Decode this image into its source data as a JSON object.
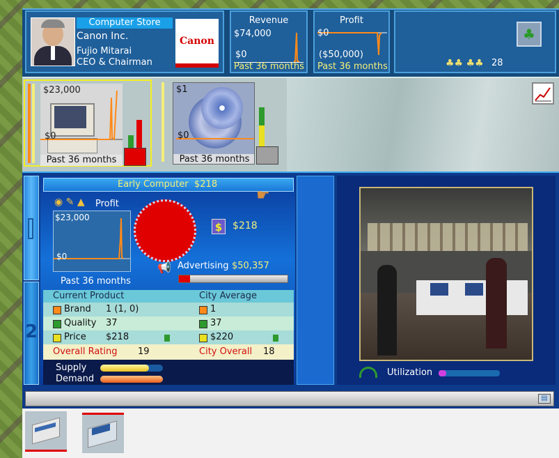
{
  "header": {
    "store_type": "Computer Store",
    "company": "Canon Inc.",
    "person_name": "Fujio Mitarai",
    "person_title": "CEO & Chairman",
    "logo_text": "Canon",
    "revenue": {
      "title": "Revenue",
      "max": "$74,000",
      "min": "$0",
      "period": "Past 36 months"
    },
    "profit": {
      "title": "Profit",
      "max": "$0",
      "min": "($50,000)",
      "period": "Past 36 months"
    },
    "employees_count": "28"
  },
  "units": [
    {
      "label": "Past 36 months",
      "max": "$23,000",
      "min": "$0"
    },
    {
      "label": "Past 36 months",
      "max": "$1",
      "min": "$0"
    }
  ],
  "detail": {
    "product_title": "Early Computer",
    "product_price": "$218",
    "profit_label": "Profit",
    "profit_max": "$23,000",
    "profit_min": "$0",
    "profit_period": "Past 36 months",
    "price_value": "$218",
    "advertising_label": "Advertising",
    "advertising_value": "$50,357",
    "advertising_level": 0.1,
    "left_tab_top": "1",
    "left_tab_bottom": "2",
    "table": {
      "col1": "Current Product",
      "col2": "City Average",
      "rows": [
        {
          "label": "Brand",
          "value": "1 (1, 0)",
          "city": "1",
          "color": "#ff8a1a"
        },
        {
          "label": "Quality",
          "value": "37",
          "city": "37",
          "color": "#2e9a2e"
        },
        {
          "label": "Price",
          "value": "$218",
          "city": "$220",
          "color": "#e8e020"
        }
      ],
      "overall_label": "Overall Rating",
      "overall_value": "19",
      "city_overall_label": "City Overall",
      "city_overall_value": "18"
    },
    "supply_label": "Supply",
    "demand_label": "Demand",
    "supply_level": 0.78,
    "demand_level": 1.0,
    "utilization_label": "Utilization",
    "utilization_level": 0.12
  },
  "colors": {
    "accent": "#f4ef7a",
    "panel": "#1f5f9a",
    "red": "#e00000",
    "orange": "#ff8a1a"
  }
}
